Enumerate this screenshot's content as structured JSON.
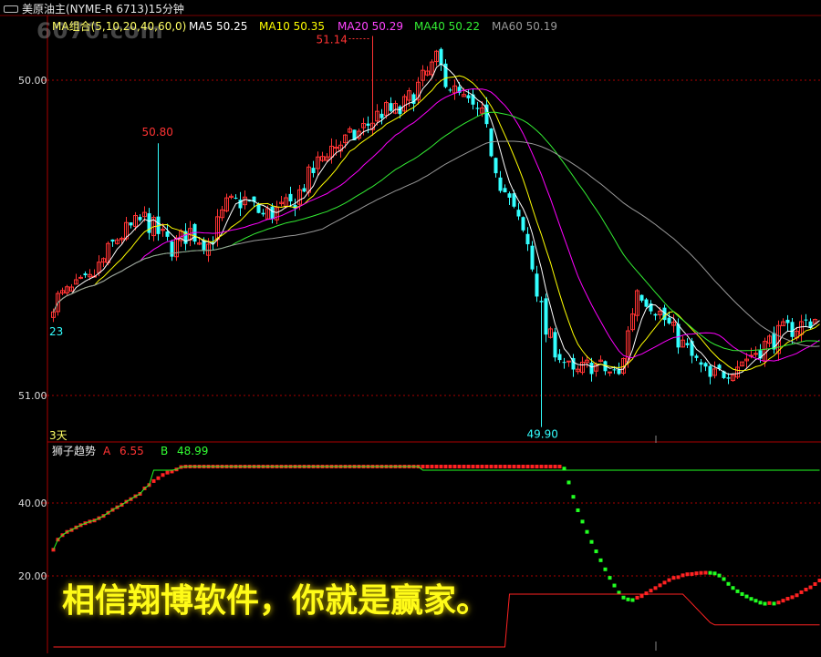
{
  "header": {
    "title": "美原油主(NYME-R 6713)15分钟",
    "watermark": "6070.com",
    "ma_group": "MA组合(5,10,20,40,60,0)",
    "ma5": "MA5 50.25",
    "ma10": "MA10 50.35",
    "ma20": "MA20 50.29",
    "ma40": "MA40 50.22",
    "ma60": "MA60 50.19"
  },
  "colors": {
    "up": "#ff3333",
    "down": "#33ffff",
    "ma5": "#ffffff",
    "ma10": "#ffff00",
    "ma20": "#ff00ff",
    "ma40": "#33ee33",
    "ma60": "#999999",
    "grid": "#aa0000",
    "axis_label": "#dddddd",
    "ind_a": "#ff2222",
    "ind_b": "#22ff22"
  },
  "main": {
    "y_ticks": [
      "51.00",
      "50.00"
    ],
    "high_label": "51.14",
    "low_label": "49.90",
    "side_label": "50.80",
    "left_label": "23",
    "period_label": "3天"
  },
  "indicator": {
    "name": "狮子趋势",
    "a_label": "A",
    "a_value": "6.55",
    "b_label": "B",
    "b_value": "48.99",
    "y_ticks": [
      "40.00",
      "20.00"
    ]
  },
  "slogan": "相信翔博软件，你就是赢家。",
  "chart_data": [
    {
      "type": "candlestick",
      "ylim": [
        49.85,
        51.2
      ],
      "y_ticks": [
        50.0,
        51.0
      ],
      "close_path": [
        [
          0,
          50.3
        ],
        [
          8,
          50.36
        ],
        [
          14,
          50.5
        ],
        [
          20,
          50.56
        ],
        [
          26,
          50.47
        ],
        [
          30,
          50.52
        ],
        [
          34,
          50.48
        ],
        [
          38,
          50.6
        ],
        [
          42,
          50.62
        ],
        [
          46,
          50.57
        ],
        [
          52,
          50.6
        ],
        [
          60,
          50.78
        ],
        [
          66,
          50.82
        ],
        [
          72,
          50.9
        ],
        [
          76,
          50.9
        ],
        [
          80,
          50.98
        ],
        [
          84,
          51.06
        ],
        [
          88,
          50.96
        ],
        [
          94,
          50.88
        ],
        [
          98,
          50.68
        ],
        [
          104,
          50.48
        ],
        [
          108,
          50.2
        ],
        [
          114,
          50.06
        ],
        [
          118,
          50.1
        ],
        [
          124,
          50.06
        ],
        [
          128,
          50.34
        ],
        [
          132,
          50.28
        ],
        [
          136,
          50.2
        ],
        [
          140,
          50.12
        ],
        [
          144,
          50.05
        ],
        [
          152,
          50.12
        ],
        [
          160,
          50.2
        ],
        [
          168,
          50.25
        ]
      ],
      "highlights": [
        {
          "label": "51.14",
          "value": 51.14
        },
        {
          "label": "49.90",
          "value": 49.9
        },
        {
          "label": "50.80",
          "value": 50.8
        }
      ]
    },
    {
      "type": "line",
      "name": "狮子趋势",
      "ylim": [
        0,
        52
      ],
      "y_ticks": [
        20,
        40
      ],
      "series": [
        {
          "name": "A",
          "value": 6.55
        },
        {
          "name": "B",
          "value": 48.99
        }
      ]
    }
  ]
}
